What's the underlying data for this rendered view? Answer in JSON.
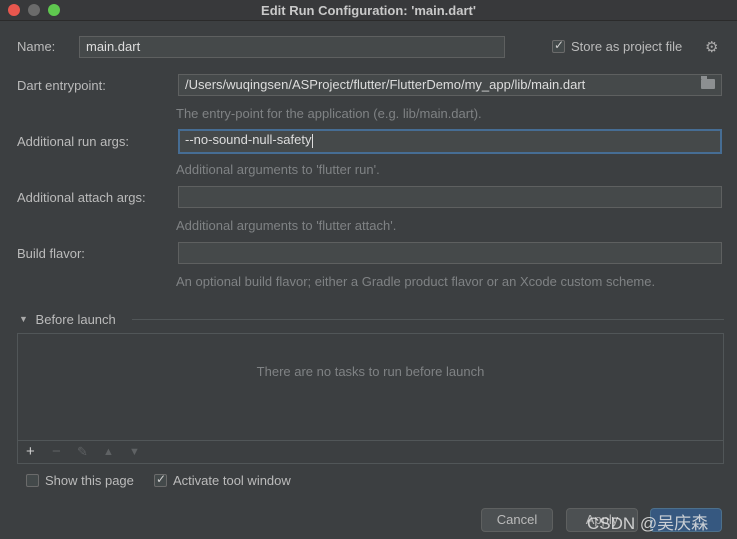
{
  "window": {
    "title": "Edit Run Configuration: 'main.dart'"
  },
  "name": {
    "label": "Name:",
    "value": "main.dart"
  },
  "store": {
    "label": "Store as project file",
    "checked": true
  },
  "entrypoint": {
    "label": "Dart entrypoint:",
    "value": "/Users/wuqingsen/ASProject/flutter/FlutterDemo/my_app/lib/main.dart",
    "hint": "The entry-point for the application (e.g. lib/main.dart)."
  },
  "run_args": {
    "label": "Additional run args:",
    "value": "--no-sound-null-safety",
    "hint": "Additional arguments to 'flutter run'."
  },
  "attach_args": {
    "label": "Additional attach args:",
    "value": "",
    "hint": "Additional arguments to 'flutter attach'."
  },
  "build_flavor": {
    "label": "Build flavor:",
    "value": "",
    "hint": "An optional build flavor; either a Gradle product flavor or an Xcode custom scheme."
  },
  "before_launch": {
    "label": "Before launch",
    "empty_text": "There are no tasks to run before launch",
    "toolbar": [
      "+",
      "−",
      "✎",
      "▲",
      "▼"
    ]
  },
  "footer": {
    "show_page_label": "Show this page",
    "show_page_checked": false,
    "activate_label": "Activate tool window",
    "activate_checked": true,
    "cancel_label": "Cancel",
    "apply_label": "Apply"
  },
  "watermark": "CSDN @吴庆森",
  "colors": {
    "background": "#3c3f41",
    "focus_border": "#466d94",
    "primary_button": "#365880"
  }
}
